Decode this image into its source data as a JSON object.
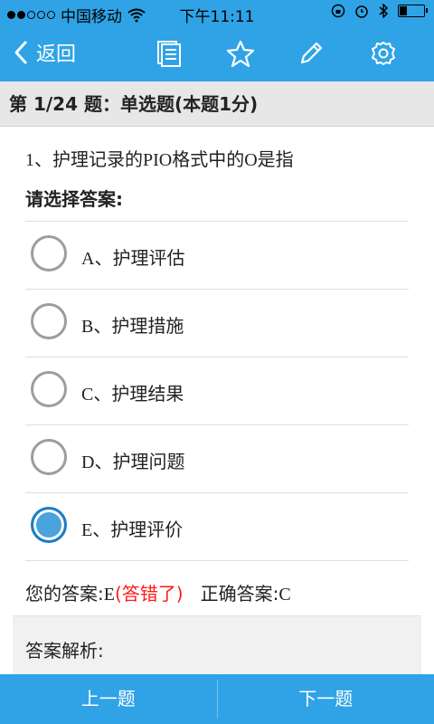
{
  "status_bar": {
    "carrier": "中国移动",
    "time": "下午11:11"
  },
  "nav": {
    "back_label": "返回",
    "icons": [
      "note-icon",
      "star-icon",
      "pencil-icon",
      "gear-icon"
    ]
  },
  "question_header": {
    "title": "第 1/24 题：单选题(本题1分)"
  },
  "question": {
    "text": "1、护理记录的PIO格式中的O是指",
    "prompt": "请选择答案:",
    "options": [
      {
        "label": "A、护理评估",
        "selected": false
      },
      {
        "label": "B、护理措施",
        "selected": false
      },
      {
        "label": "C、护理结果",
        "selected": false
      },
      {
        "label": "D、护理问题",
        "selected": false
      },
      {
        "label": "E、护理评价",
        "selected": true
      }
    ]
  },
  "answer": {
    "your_label": "您的答案:",
    "your_value": "E",
    "wrong_text": "(答错了)",
    "correct_label": "正确答案:",
    "correct_value": "C"
  },
  "analysis": {
    "label": "答案解析:"
  },
  "bottom": {
    "prev_label": "上一题",
    "next_label": "下一题"
  },
  "colors": {
    "primary": "#2fa3e6",
    "wrong": "#ff1a1a"
  }
}
